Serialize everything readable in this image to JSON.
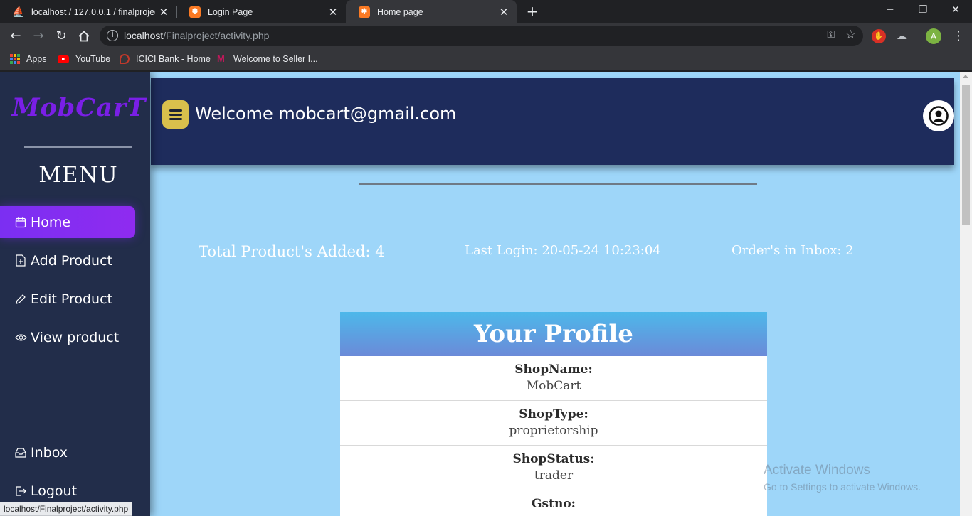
{
  "browser": {
    "tabs": [
      {
        "title": "localhost / 127.0.0.1 / finalproject",
        "icon": "phpmyadmin-icon",
        "active": false
      },
      {
        "title": "Login Page",
        "icon": "xampp-icon",
        "active": false
      },
      {
        "title": "Home page",
        "icon": "xampp-icon",
        "active": true
      }
    ],
    "address": {
      "host": "localhost",
      "path": "/Finalproject/activity.php"
    },
    "bookmarks": [
      {
        "label": "Apps",
        "icon": "apps-grid-icon"
      },
      {
        "label": "YouTube",
        "icon": "youtube-icon"
      },
      {
        "label": "ICICI Bank - Home",
        "icon": "icici-icon"
      },
      {
        "label": "Welcome to Seller I...",
        "icon": "meesho-icon"
      }
    ],
    "profile_initial": "A",
    "status_url": "localhost/Finalproject/activity.php"
  },
  "sidebar": {
    "logo": "MobCarT",
    "menu_title": "MENU",
    "items": [
      {
        "label": "Home",
        "icon": "calendar-icon"
      },
      {
        "label": "Add Product",
        "icon": "file-plus-icon"
      },
      {
        "label": "Edit Product",
        "icon": "pencil-icon"
      },
      {
        "label": "View product",
        "icon": "eye-icon"
      },
      {
        "label": "Inbox",
        "icon": "inbox-icon"
      },
      {
        "label": "Logout",
        "icon": "logout-icon"
      }
    ]
  },
  "header": {
    "welcome": "Welcome mobcart@gmail.com"
  },
  "stats": {
    "total_products": "Total Product's Added: 4",
    "last_login": "Last Login: 20-05-24 10:23:04",
    "orders_inbox": "Order's in Inbox: 2"
  },
  "profile": {
    "title": "Your Profile",
    "fields": [
      {
        "label": "ShopName:",
        "value": "MobCart"
      },
      {
        "label": "ShopType:",
        "value": "proprietorship"
      },
      {
        "label": "ShopStatus:",
        "value": "trader"
      },
      {
        "label": "Gstno:",
        "value": ""
      }
    ]
  },
  "watermark": {
    "line1": "Activate Windows",
    "line2": "Go to Settings to activate Windows."
  },
  "colors": {
    "page_bg": "#9ed6f9",
    "sidebar_bg": "#222d4a",
    "topbar_bg": "#1e2c5c",
    "accent": "#7b2ff2",
    "hamburger": "#d9c04c"
  }
}
